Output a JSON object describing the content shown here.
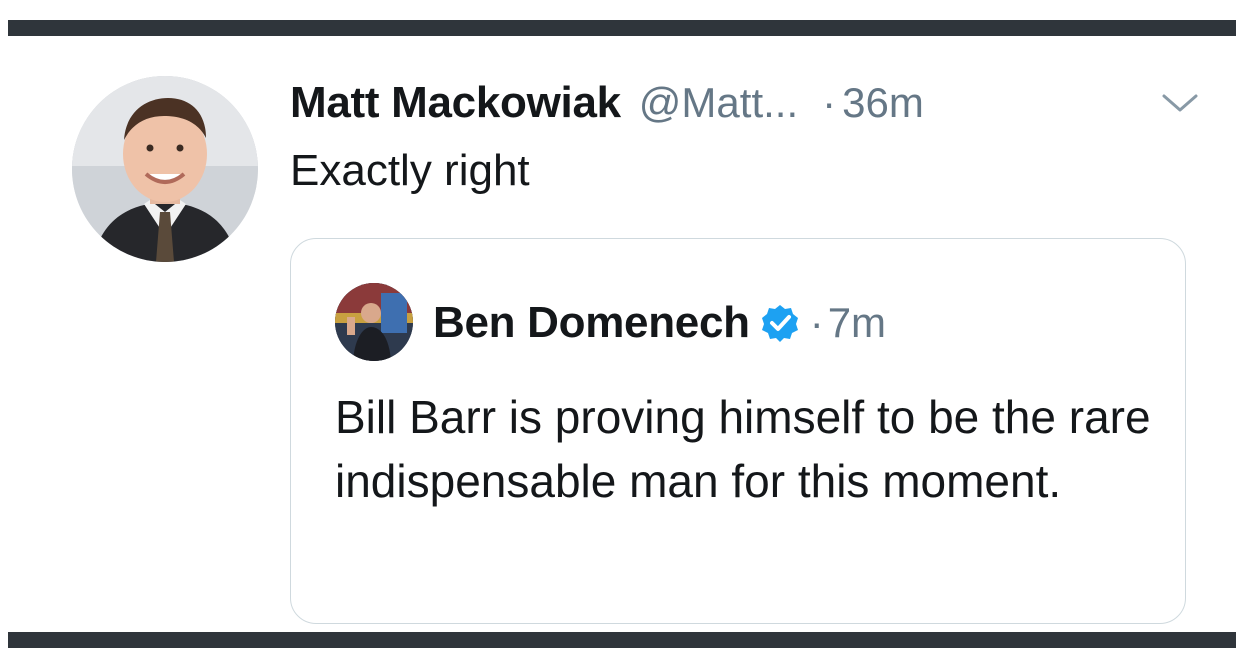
{
  "tweet": {
    "author_name": "Matt Mackowiak",
    "author_handle": "@Matt...",
    "separator": "·",
    "timestamp": "36m",
    "text": "Exactly right",
    "avatar_icon": "profile-photo",
    "menu_icon": "chevron-down-icon"
  },
  "quoted_tweet": {
    "author_name": "Ben Domenech",
    "verified": true,
    "separator": "·",
    "timestamp": "7m",
    "text": "Bill Barr is proving himself to be the rare indispensable man for this moment.",
    "avatar_icon": "profile-photo"
  },
  "colors": {
    "text_primary": "#14171a",
    "text_secondary": "#657786",
    "verified_blue": "#1da1f2",
    "card_border": "#cfd9de",
    "frame_bar": "#2f353b"
  }
}
